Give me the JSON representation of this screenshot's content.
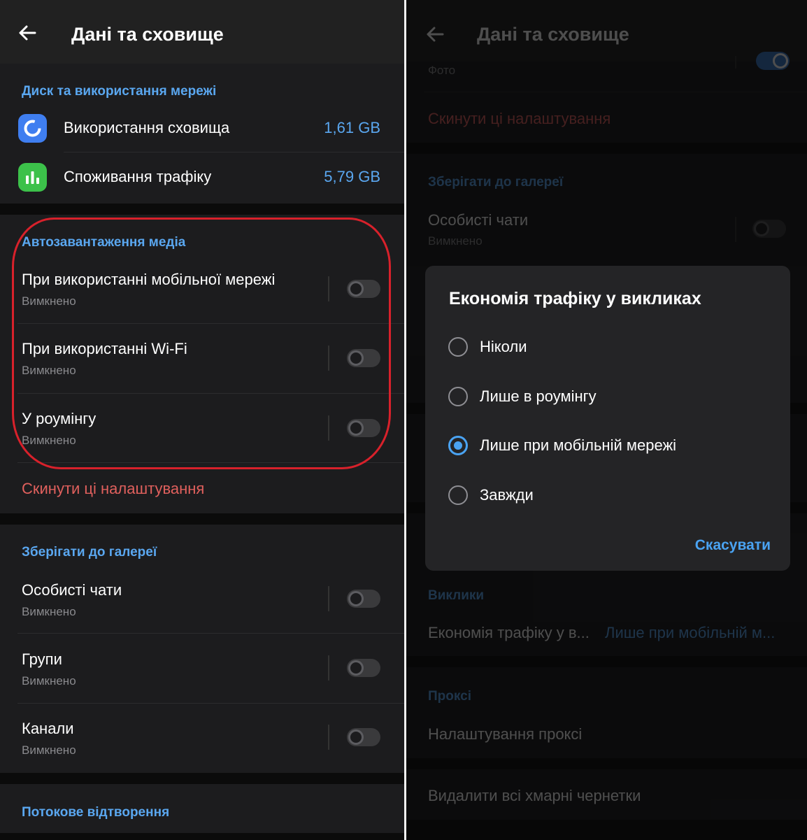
{
  "left": {
    "appbar": {
      "title": "Дані та сховище"
    },
    "disk": {
      "header": "Диск та використання мережі",
      "storage": {
        "label": "Використання сховища",
        "value": "1,61 GB"
      },
      "traffic": {
        "label": "Споживання трафіку",
        "value": "5,79 GB"
      }
    },
    "autodownload": {
      "header": "Автозавантаження медіа",
      "items": [
        {
          "title": "При використанні мобільної мережі",
          "sub": "Вимкнено"
        },
        {
          "title": "При використанні Wi-Fi",
          "sub": "Вимкнено"
        },
        {
          "title": "У роумінгу",
          "sub": "Вимкнено"
        }
      ],
      "reset": "Скинути ці налаштування"
    },
    "gallery": {
      "header": "Зберігати до галереї",
      "items": [
        {
          "title": "Особисті чати",
          "sub": "Вимкнено"
        },
        {
          "title": "Групи",
          "sub": "Вимкнено"
        },
        {
          "title": "Канали",
          "sub": "Вимкнено"
        }
      ]
    },
    "streaming": {
      "header": "Потокове відтворення"
    }
  },
  "right": {
    "appbar": {
      "title": "Дані та сховище"
    },
    "partial_row": {
      "sub": "Фото"
    },
    "reset": "Скинути ці налаштування",
    "gallery": {
      "header": "Зберігати до галереї",
      "item": {
        "title": "Особисті чати",
        "sub": "Вимкнено"
      }
    },
    "calls": {
      "header": "Виклики",
      "row_label": "Економія трафіку у в...",
      "row_value": "Лише при мобільній м..."
    },
    "proxy": {
      "header": "Проксі",
      "settings": "Налаштування проксі"
    },
    "delete_drafts": "Видалити всі хмарні чернетки",
    "dialog": {
      "title": "Економія трафіку у викликах",
      "options": [
        "Ніколи",
        "Лише в роумінгу",
        "Лише при мобільній мережі",
        "Завжди"
      ],
      "selected_index": 2,
      "cancel": "Скасувати"
    }
  },
  "colors": {
    "accent": "#5aa7f0",
    "danger": "#e0605d",
    "highlight_ring": "#d8212b",
    "storage_icon": "#3f7ef0",
    "traffic_icon": "#3cc14a"
  }
}
